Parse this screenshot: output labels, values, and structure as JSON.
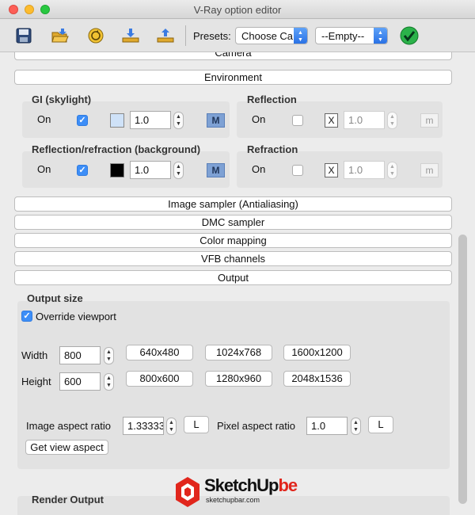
{
  "window": {
    "title": "V-Ray option editor"
  },
  "toolbar": {
    "presets_label": "Presets:",
    "preset_select": "Choose Ca",
    "preset_value_select": "--Empty--",
    "icons": [
      "save-icon",
      "open-folder-icon",
      "reset-icon",
      "import-icon",
      "export-icon",
      "apply-check-icon"
    ]
  },
  "sections": {
    "camera_partial": "Camera",
    "environment": "Environment",
    "image_sampler": "Image sampler (Antialiasing)",
    "dmc_sampler": "DMC sampler",
    "color_mapping": "Color mapping",
    "vfb_channels": "VFB channels",
    "output": "Output"
  },
  "environment": {
    "gi": {
      "title": "GI (skylight)",
      "on_label": "On",
      "checked": true,
      "swatch_color": "#cfe2f8",
      "value": "1.0",
      "map_label": "M",
      "map_active": true
    },
    "reflection": {
      "title": "Reflection",
      "on_label": "On",
      "checked": false,
      "x_label": "X",
      "value": "1.0",
      "map_label": "m",
      "map_active": false
    },
    "refl_refr": {
      "title": "Reflection/refraction (background)",
      "on_label": "On",
      "checked": true,
      "swatch_color": "#000000",
      "value": "1.0",
      "map_label": "M",
      "map_active": true
    },
    "refraction": {
      "title": "Refraction",
      "on_label": "On",
      "checked": false,
      "x_label": "X",
      "value": "1.0",
      "map_label": "m",
      "map_active": false
    }
  },
  "output": {
    "group_title": "Output size",
    "override_label": "Override viewport",
    "override_checked": true,
    "width_label": "Width",
    "width_value": "800",
    "height_label": "Height",
    "height_value": "600",
    "presets_row1": [
      "640x480",
      "1024x768",
      "1600x1200"
    ],
    "presets_row2": [
      "800x600",
      "1280x960",
      "2048x1536"
    ],
    "image_aspect_label": "Image aspect ratio",
    "image_aspect_value": "1.33333",
    "image_aspect_lock": "L",
    "pixel_aspect_label": "Pixel aspect ratio",
    "pixel_aspect_value": "1.0",
    "pixel_aspect_lock": "L",
    "get_view_aspect": "Get view aspect"
  },
  "render_output": {
    "title": "Render Output"
  },
  "watermark": {
    "brand": "SketchUp",
    "brand_suffix": "be",
    "site": "sketchupbar.com"
  }
}
